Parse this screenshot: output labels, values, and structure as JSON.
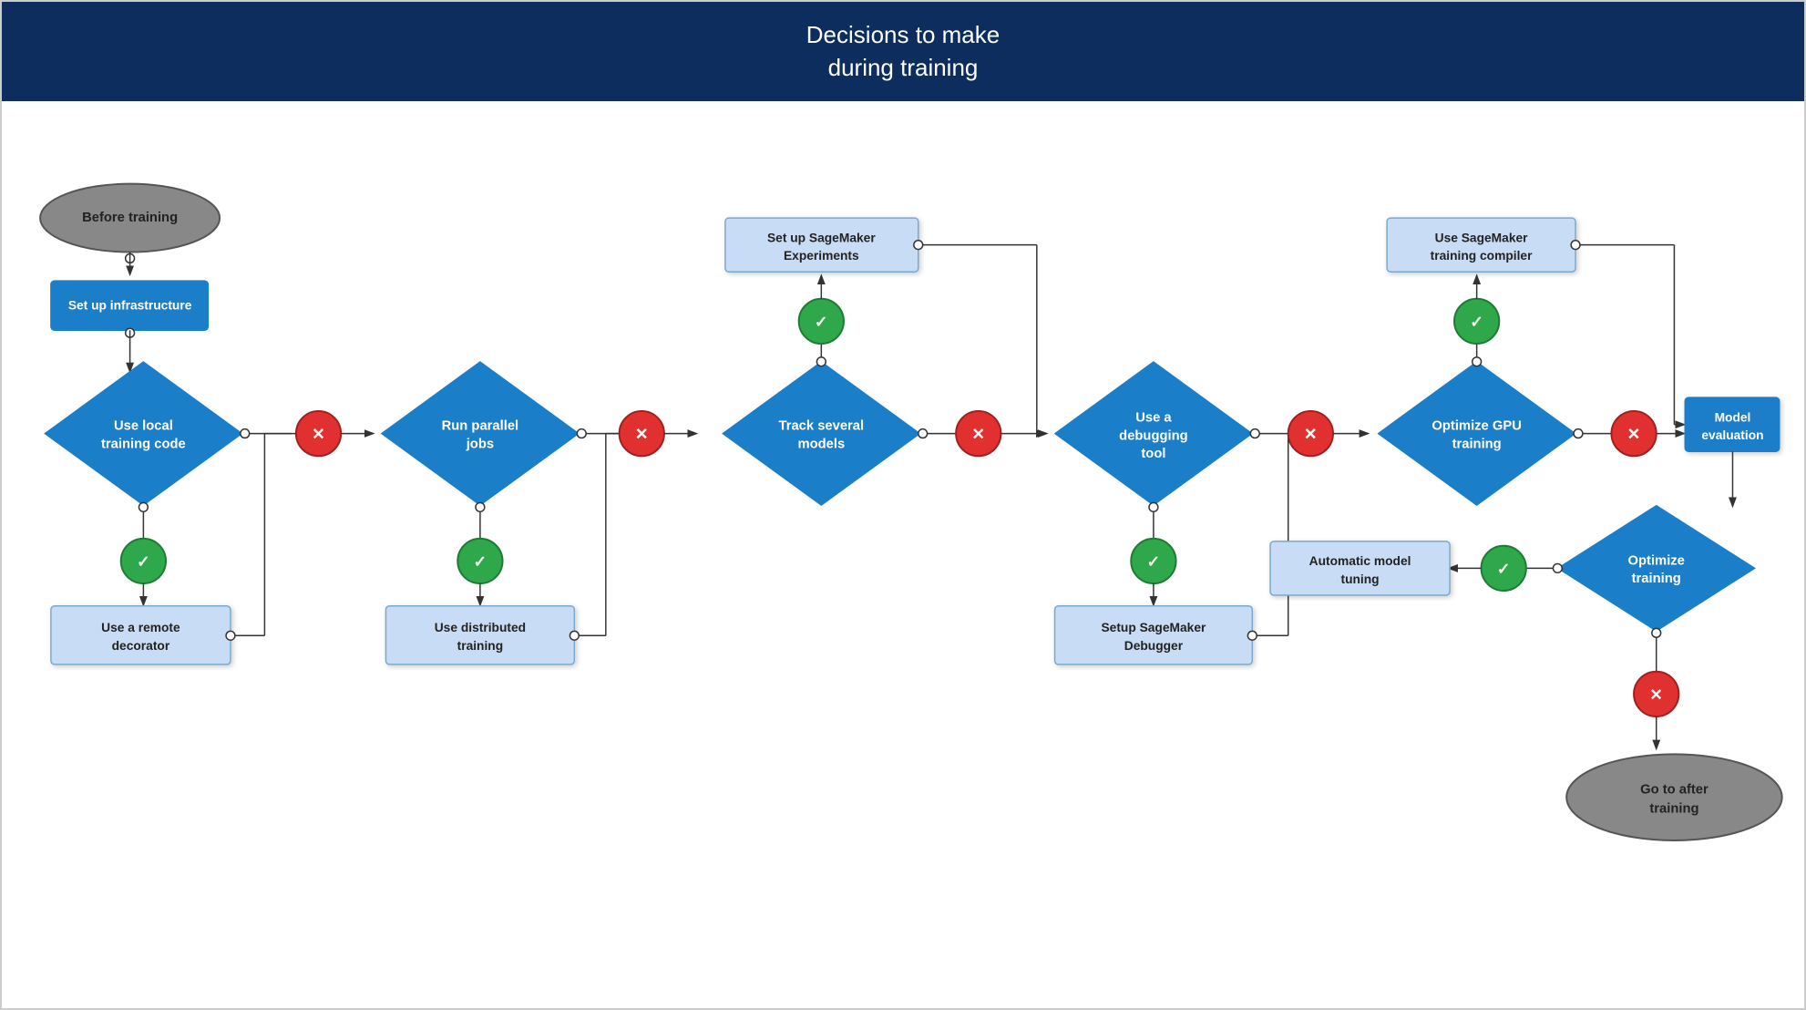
{
  "header": {
    "line1": "Decisions to make",
    "line2": "during training"
  },
  "nodes": {
    "before_training": "Before training",
    "setup_infra": "Set up infrastructure",
    "use_local_training": "Use local\ntraining code",
    "use_remote_decorator": "Use a remote\ndecorator",
    "run_parallel_jobs": "Run parallel\njobs",
    "use_distributed_training": "Use distributed\ntraining",
    "track_several_models": "Track several\nmodels",
    "setup_sagemaker_experiments": "Set up SageMaker\nExperiments",
    "use_debugging_tool": "Use a\ndebugging\ntool",
    "setup_sagemaker_debugger": "Setup SageMaker\nDebugger",
    "optimize_gpu": "Optimize GPU\ntraining",
    "sagemaker_compiler": "Use SageMaker\ntraining compiler",
    "model_evaluation": "Model evaluation",
    "optimize_training": "Optimize\ntraining",
    "automatic_model_tuning": "Automatic model\ntuning",
    "go_after_training": "Go to after\ntraining"
  }
}
